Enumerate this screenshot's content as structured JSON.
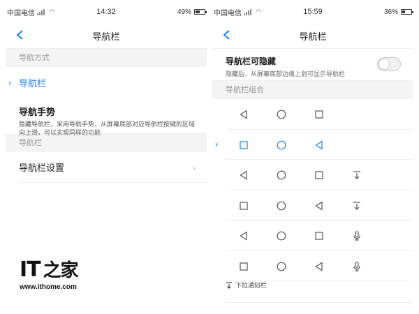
{
  "left_phone": {
    "status": {
      "carrier": "中国电信",
      "time": "14:32",
      "battery": "49%",
      "battery_level": 0.49
    },
    "header": {
      "title": "导航栏"
    },
    "sections": [
      {
        "header": "导航方式"
      },
      {
        "header": "导航栏"
      }
    ],
    "selected_option": {
      "label": "导航栏",
      "mark": "›"
    },
    "gesture_option": {
      "label": "导航手势",
      "description": "隐藏导航栏，采用导航手势，从屏幕底部对应导航栏按键的区域向上滑，可以实现同样的功能"
    },
    "settings_row": {
      "label": "导航栏设置",
      "chevron": "›"
    }
  },
  "right_phone": {
    "status": {
      "carrier": "中国电信",
      "time": "15:59",
      "battery": "36%",
      "battery_level": 0.36
    },
    "header": {
      "title": "导航栏"
    },
    "hide_toggle": {
      "label": "导航栏可隐藏",
      "description": "隐藏后，从屏幕底部边缘上划可显示导航栏",
      "on": false
    },
    "combo_header": "导航栏组合",
    "selected_mark": "›",
    "combos": [
      {
        "icons": [
          "back-triangle-icon",
          "home-circle-icon",
          "recent-square-icon"
        ],
        "selected": false
      },
      {
        "icons": [
          "recent-square-icon",
          "home-circle-icon",
          "back-triangle-icon"
        ],
        "selected": true
      },
      {
        "icons": [
          "back-triangle-icon",
          "home-circle-icon",
          "recent-square-icon",
          "pulldown-icon"
        ],
        "selected": false
      },
      {
        "icons": [
          "recent-square-icon",
          "home-circle-icon",
          "back-triangle-icon",
          "pulldown-icon"
        ],
        "selected": false
      },
      {
        "icons": [
          "back-triangle-icon",
          "home-circle-icon",
          "recent-square-icon",
          "mic-icon"
        ],
        "selected": false
      },
      {
        "icons": [
          "recent-square-icon",
          "home-circle-icon",
          "back-triangle-icon",
          "mic-icon"
        ],
        "selected": false
      }
    ],
    "pulldown_legend": "下拉通知栏"
  },
  "watermark": {
    "brand": "IT",
    "brand_char": "之家",
    "url": "www.ithome.com"
  },
  "colors": {
    "accent": "#1c7ff0",
    "section_bg": "#f4f4f4",
    "divider": "#eeeeee"
  }
}
